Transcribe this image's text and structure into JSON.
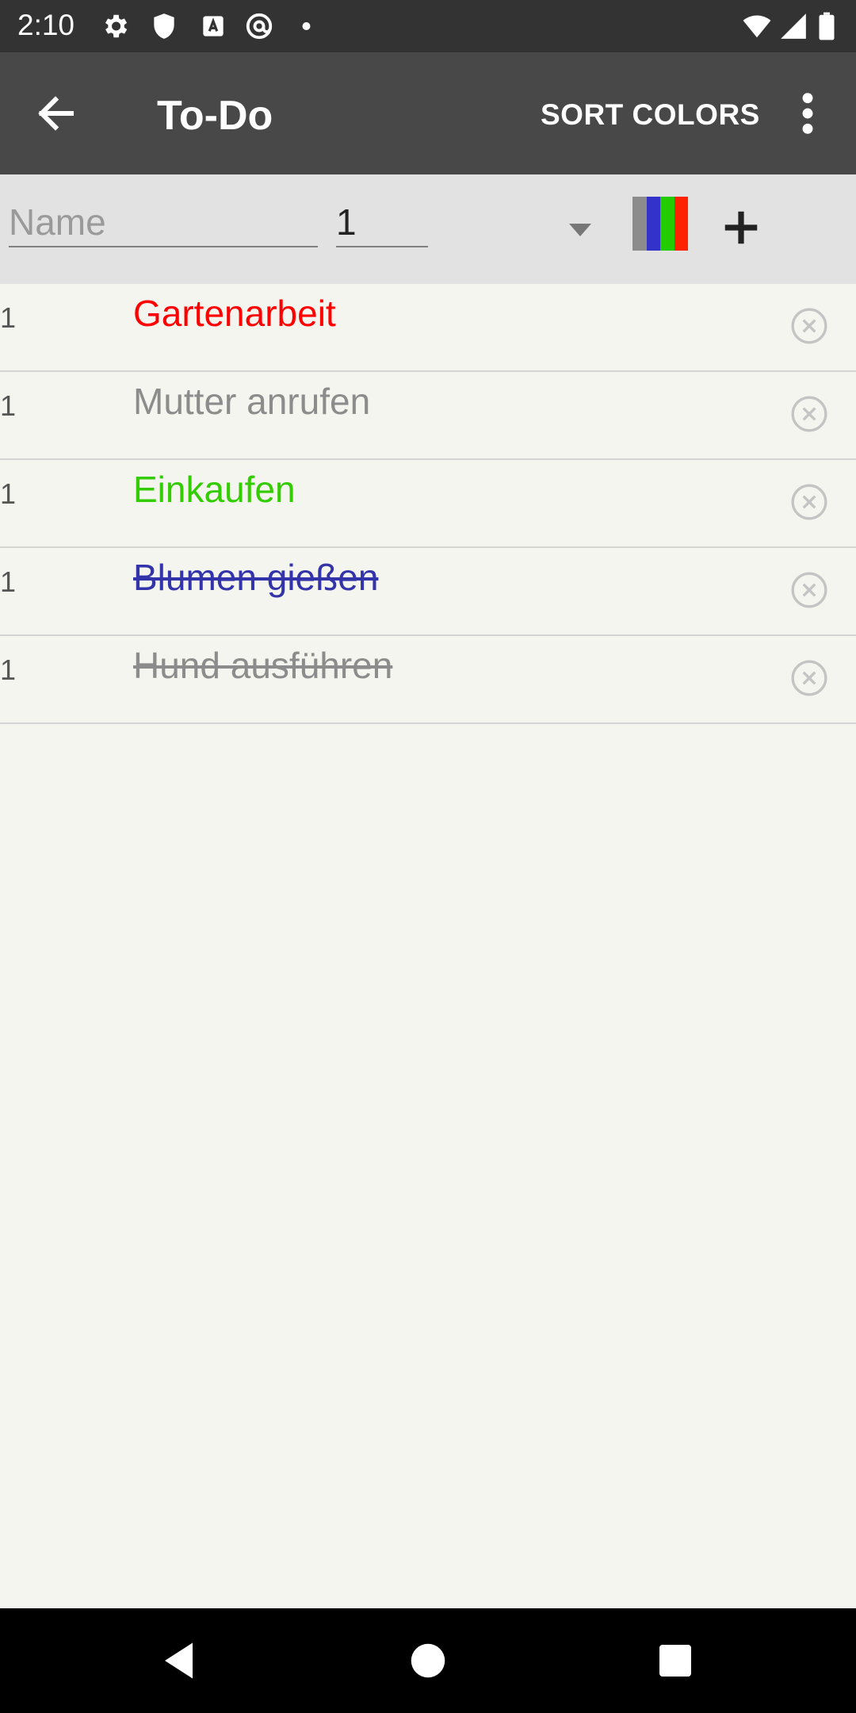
{
  "status_bar": {
    "time": "2:10",
    "icons": [
      "gear-icon",
      "shield-icon",
      "keyboard-a-icon",
      "at-sign-icon",
      "dot-icon",
      "wifi-icon",
      "signal-icon",
      "battery-icon"
    ]
  },
  "app_bar": {
    "title": "To-Do",
    "sort_colors_label": "SORT COLORS",
    "back_icon": "arrow-left-icon",
    "overflow_icon": "more-vert-icon"
  },
  "input_row": {
    "name_placeholder": "Name",
    "name_value": "",
    "quantity_value": "1",
    "color_picker_colors": [
      "#8c8c8c",
      "#3333cc",
      "#22cc00",
      "#ff2200"
    ],
    "add_icon": "plus-icon",
    "dropdown_icon": "dropdown-triangle-icon"
  },
  "items": [
    {
      "qty": "1",
      "name": "Gartenarbeit",
      "color": "#ff0000",
      "done": false
    },
    {
      "qty": "1",
      "name": "Mutter anrufen",
      "color": "#8c8c8c",
      "done": false
    },
    {
      "qty": "1",
      "name": "Einkaufen",
      "color": "#33cc00",
      "done": false
    },
    {
      "qty": "1",
      "name": "Blumen gießen",
      "color": "#3333aa",
      "done": true
    },
    {
      "qty": "1",
      "name": "Hund ausführen",
      "color": "#8c8c8c",
      "done": true
    }
  ],
  "nav_bar": {
    "icons": [
      "back-triangle-icon",
      "home-circle-icon",
      "recents-square-icon"
    ]
  },
  "colors": {
    "status_bar": "#333333",
    "app_bar": "#484848",
    "input_row": "#e2e2e2",
    "background": "#f5f5ef",
    "nav_bar": "#000000"
  }
}
